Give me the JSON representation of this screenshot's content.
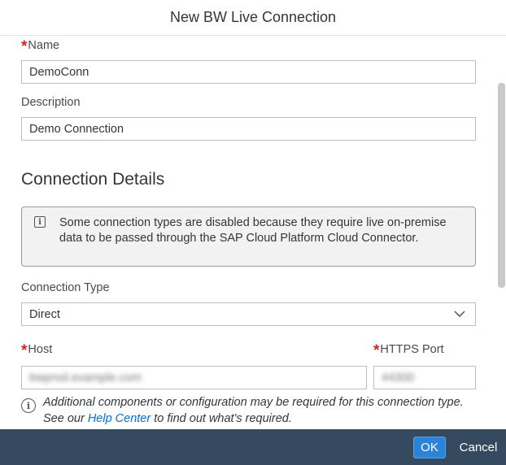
{
  "dialog": {
    "title": "New BW Live Connection"
  },
  "form": {
    "name": {
      "label": "Name",
      "required_mark": "*",
      "value": "DemoConn"
    },
    "description": {
      "label": "Description",
      "value": "Demo Connection"
    },
    "section_title": "Connection Details",
    "info_message": "Some connection types are disabled because they require live on-premise data to be passed through the SAP Cloud Platform Cloud Connector.",
    "connection_type": {
      "label": "Connection Type",
      "selected": "Direct"
    },
    "host": {
      "label": "Host",
      "required_mark": "*",
      "value": "bwprod.example.com"
    },
    "https_port": {
      "label": "HTTPS Port",
      "required_mark": "*",
      "value": "44300"
    },
    "note": {
      "prefix": "Additional components or configuration may be required for this connection type. See our ",
      "link_text": "Help Center",
      "suffix": " to find out what's required."
    }
  },
  "footer": {
    "ok_label": "OK",
    "cancel_label": "Cancel"
  },
  "colors": {
    "footer_bg": "#354a5f",
    "primary_button": "#2c84d8",
    "required": "#d0271d",
    "link": "#0a6ed1"
  },
  "icons": {
    "info_box": "info-square-icon",
    "note": "info-circle-icon",
    "dropdown": "chevron-down-icon"
  }
}
